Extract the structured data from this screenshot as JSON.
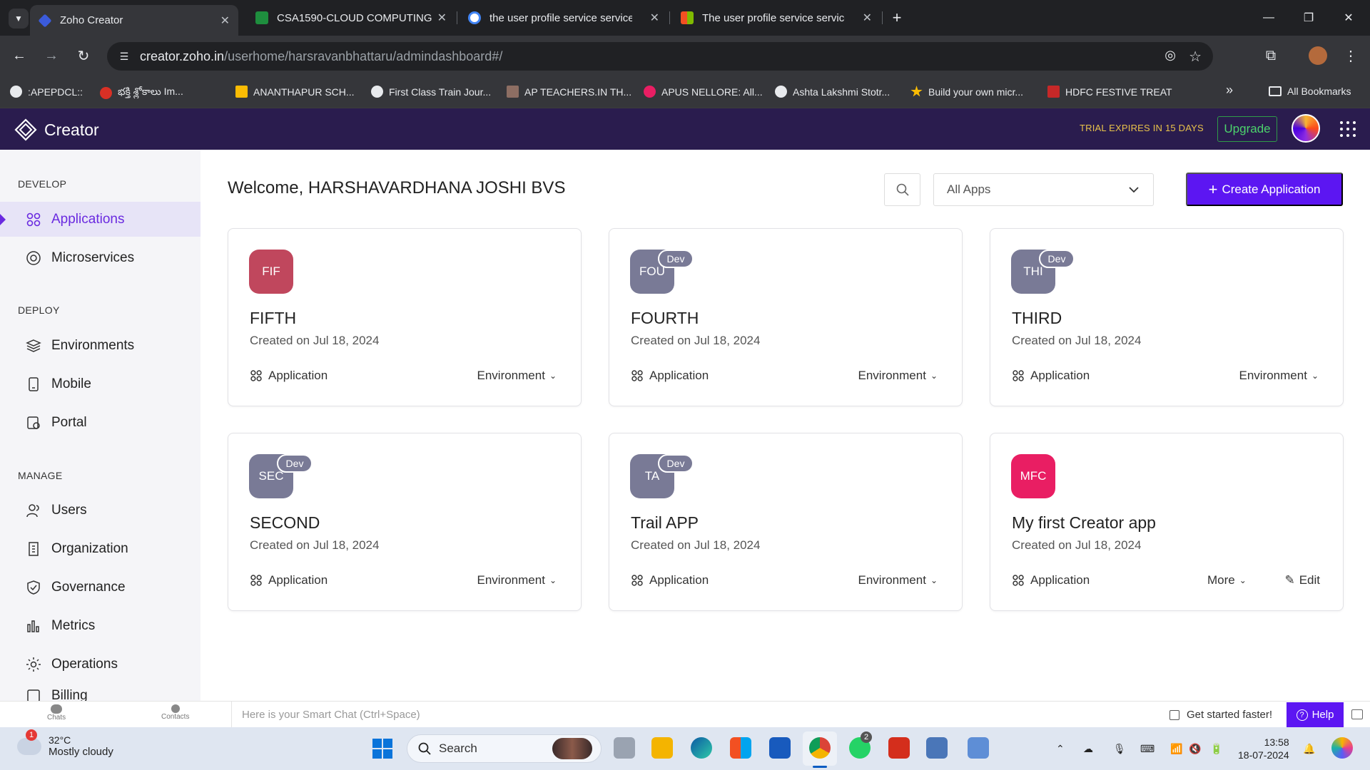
{
  "browser": {
    "tabs": [
      {
        "title": "Zoho Creator",
        "active": true,
        "favicon_color": "#3b5bdb"
      },
      {
        "title": "CSA1590-CLOUD COMPUTING",
        "active": false,
        "favicon_color": "#1e8e3e"
      },
      {
        "title": "the user profile service service f",
        "active": false,
        "favicon_color": "#4285f4"
      },
      {
        "title": "The user profile service service f",
        "active": false,
        "favicon_color": "#f25022"
      }
    ],
    "new_tab": "+",
    "url_host": "creator.zoho.in",
    "url_path": "/userhome/harsravanbhattaru/admindashboard#/",
    "bookmarks": [
      {
        "label": ":APEPDCL::",
        "color": "#e8eaed"
      },
      {
        "label": "భక్తి శ్లోకాలు Im...",
        "color": "#d93025"
      },
      {
        "label": "ANANTHAPUR SCH...",
        "color": "#fbbc04"
      },
      {
        "label": "First Class Train Jour...",
        "color": "#e8eaed"
      },
      {
        "label": "AP TEACHERS.IN TH...",
        "color": "#8d6e63"
      },
      {
        "label": "APUS NELLORE: All...",
        "color": "#e91e63"
      },
      {
        "label": "Ashta Lakshmi Stotr...",
        "color": "#e8eaed"
      },
      {
        "label": "Build your own micr...",
        "color": "#fbbc04"
      },
      {
        "label": "HDFC FESTIVE TREAT",
        "color": "#c62828"
      }
    ],
    "all_bookmarks": "All Bookmarks"
  },
  "header": {
    "brand": "Creator",
    "trial": "TRIAL EXPIRES IN 15 DAYS",
    "upgrade": "Upgrade"
  },
  "sidebar": {
    "develop_label": "DEVELOP",
    "deploy_label": "DEPLOY",
    "manage_label": "MANAGE",
    "items": [
      {
        "label": "Applications",
        "icon": "grid-icon",
        "active": true
      },
      {
        "label": "Microservices",
        "icon": "microservices-icon"
      },
      {
        "label": "Environments",
        "icon": "layers-icon"
      },
      {
        "label": "Mobile",
        "icon": "mobile-icon"
      },
      {
        "label": "Portal",
        "icon": "portal-icon"
      },
      {
        "label": "Users",
        "icon": "users-icon"
      },
      {
        "label": "Organization",
        "icon": "building-icon"
      },
      {
        "label": "Governance",
        "icon": "shield-icon"
      },
      {
        "label": "Metrics",
        "icon": "bar-chart-icon"
      },
      {
        "label": "Operations",
        "icon": "gear-icon"
      },
      {
        "label": "Billing",
        "icon": "billing-icon"
      }
    ]
  },
  "main": {
    "welcome": "Welcome, HARSHAVARDHANA JOSHI BVS",
    "filter_value": "All Apps",
    "create_label": "Create Application",
    "cards": [
      {
        "abbr": "FIF",
        "name": "FIFTH",
        "date": "Created on Jul 18, 2024",
        "color": "#c0475d",
        "dev": "",
        "app": "Application",
        "env": "Environment"
      },
      {
        "abbr": "FOU",
        "name": "FOURTH",
        "date": "Created on Jul 18, 2024",
        "color": "#797a96",
        "dev": "Dev",
        "app": "Application",
        "env": "Environment"
      },
      {
        "abbr": "THI",
        "name": "THIRD",
        "date": "Created on Jul 18, 2024",
        "color": "#797a96",
        "dev": "Dev",
        "app": "Application",
        "env": "Environment"
      },
      {
        "abbr": "SEC",
        "name": "SECOND",
        "date": "Created on Jul 18, 2024",
        "color": "#797a96",
        "dev": "Dev",
        "app": "Application",
        "env": "Environment"
      },
      {
        "abbr": "TA",
        "name": "Trail APP",
        "date": "Created on Jul 18, 2024",
        "color": "#797a96",
        "dev": "Dev",
        "app": "Application",
        "env": "Environment"
      },
      {
        "abbr": "MFC",
        "name": "My first Creator app",
        "date": "Created on Jul 18, 2024",
        "color": "#e91e63",
        "dev": "",
        "app": "Application",
        "more": "More",
        "edit": "Edit"
      }
    ]
  },
  "bottom": {
    "chats": "Chats",
    "contacts": "Contacts",
    "smartchat_placeholder": "Here is your Smart Chat (Ctrl+Space)",
    "get_started": "Get started faster!",
    "help": "Help"
  },
  "taskbar": {
    "weather_badge": "1",
    "temp": "32°C",
    "condition": "Mostly cloudy",
    "search": "Search",
    "whatsapp_badge": "2",
    "time": "13:58",
    "date": "18-07-2024"
  }
}
